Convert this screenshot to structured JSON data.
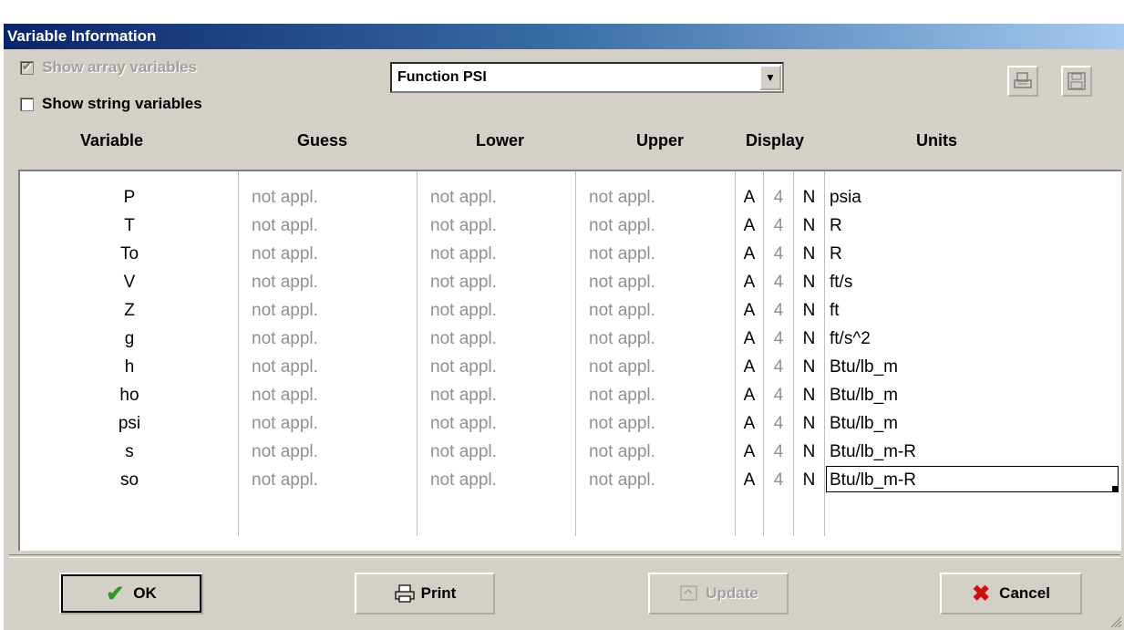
{
  "window": {
    "title": "Variable Information"
  },
  "options": {
    "show_array": {
      "label": "Show array variables",
      "checked": true,
      "enabled": false
    },
    "show_string": {
      "label": "Show string variables",
      "checked": false
    }
  },
  "function_select": {
    "value": "Function PSI"
  },
  "toolbar": {
    "print_icon": "print-preview-icon",
    "save_icon": "save-disk-icon"
  },
  "columns": [
    "Variable",
    "Guess",
    "Lower",
    "Upper",
    "Display",
    "Units"
  ],
  "rows": [
    {
      "variable": "P",
      "guess": "not appl.",
      "lower": "not appl.",
      "upper": "not appl.",
      "fmt": "A",
      "digits": "4",
      "units_flag": "N",
      "units": "psia"
    },
    {
      "variable": "T",
      "guess": "not appl.",
      "lower": "not appl.",
      "upper": "not appl.",
      "fmt": "A",
      "digits": "4",
      "units_flag": "N",
      "units": "R"
    },
    {
      "variable": "To",
      "guess": "not appl.",
      "lower": "not appl.",
      "upper": "not appl.",
      "fmt": "A",
      "digits": "4",
      "units_flag": "N",
      "units": "R"
    },
    {
      "variable": "V",
      "guess": "not appl.",
      "lower": "not appl.",
      "upper": "not appl.",
      "fmt": "A",
      "digits": "4",
      "units_flag": "N",
      "units": "ft/s"
    },
    {
      "variable": "Z",
      "guess": "not appl.",
      "lower": "not appl.",
      "upper": "not appl.",
      "fmt": "A",
      "digits": "4",
      "units_flag": "N",
      "units": "ft"
    },
    {
      "variable": "g",
      "guess": "not appl.",
      "lower": "not appl.",
      "upper": "not appl.",
      "fmt": "A",
      "digits": "4",
      "units_flag": "N",
      "units": "ft/s^2"
    },
    {
      "variable": "h",
      "guess": "not appl.",
      "lower": "not appl.",
      "upper": "not appl.",
      "fmt": "A",
      "digits": "4",
      "units_flag": "N",
      "units": "Btu/lb_m"
    },
    {
      "variable": "ho",
      "guess": "not appl.",
      "lower": "not appl.",
      "upper": "not appl.",
      "fmt": "A",
      "digits": "4",
      "units_flag": "N",
      "units": "Btu/lb_m"
    },
    {
      "variable": "psi",
      "guess": "not appl.",
      "lower": "not appl.",
      "upper": "not appl.",
      "fmt": "A",
      "digits": "4",
      "units_flag": "N",
      "units": "Btu/lb_m"
    },
    {
      "variable": "s",
      "guess": "not appl.",
      "lower": "not appl.",
      "upper": "not appl.",
      "fmt": "A",
      "digits": "4",
      "units_flag": "N",
      "units": "Btu/lb_m-R"
    },
    {
      "variable": "so",
      "guess": "not appl.",
      "lower": "not appl.",
      "upper": "not appl.",
      "fmt": "A",
      "digits": "4",
      "units_flag": "N",
      "units": "Btu/lb_m-R"
    }
  ],
  "buttons": {
    "ok": "OK",
    "print": "Print",
    "update": "Update",
    "cancel": "Cancel"
  },
  "colors": {
    "title_start": "#0a246a",
    "title_end": "#a6caf0",
    "dialog_bg": "#d4d0c8",
    "ok_check": "#2e9b1f",
    "cancel_x": "#cc1111"
  }
}
